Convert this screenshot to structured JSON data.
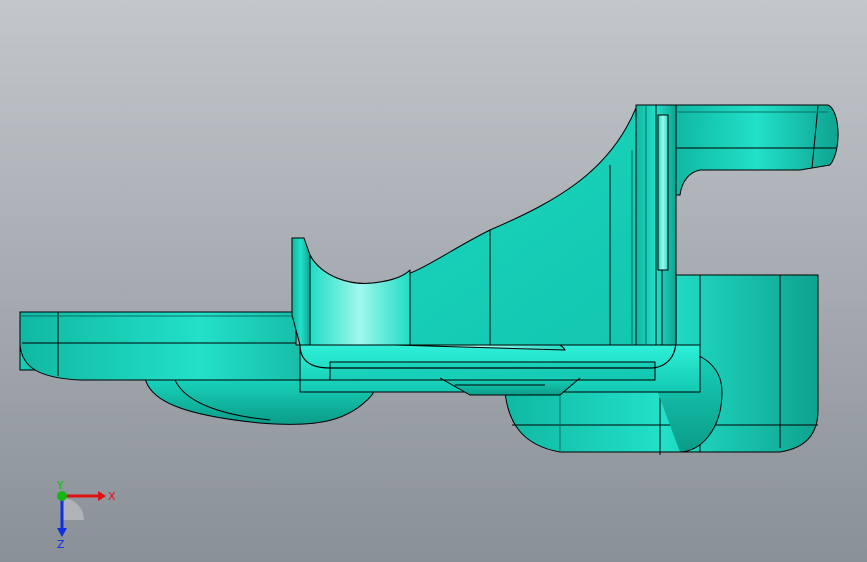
{
  "viewport": {
    "background_top": "#c3c7cb",
    "background_bottom": "#8a9097"
  },
  "model": {
    "face_color": "#1de3cc",
    "highlight_color": "#8ff5ea",
    "shadow_color": "#0fa894",
    "edge_color": "#000000"
  },
  "triad": {
    "x_label": "X",
    "y_label": "Y",
    "z_label": "Z",
    "x_color": "#e01010",
    "y_color": "#14b814",
    "z_color": "#1030e0"
  }
}
